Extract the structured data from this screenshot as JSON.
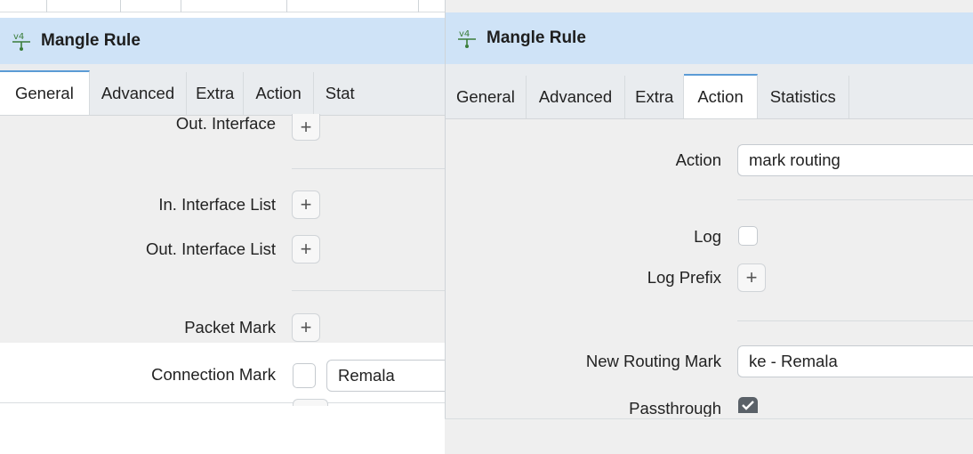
{
  "left_window": {
    "title": "Mangle Rule",
    "icon": "mangle-rule-icon",
    "tabs": [
      "General",
      "Advanced",
      "Extra",
      "Action",
      "Stat"
    ],
    "active_tab": "General",
    "fields": {
      "out_interface": "Out. Interface",
      "in_interface_list": "In. Interface List",
      "out_interface_list": "Out. Interface List",
      "packet_mark": "Packet Mark",
      "connection_mark": "Connection Mark",
      "connection_mark_value": "Remala"
    },
    "plus_symbol": "+"
  },
  "right_window": {
    "title": "Mangle Rule",
    "icon": "mangle-rule-icon",
    "tabs": [
      "General",
      "Advanced",
      "Extra",
      "Action",
      "Statistics"
    ],
    "active_tab": "Action",
    "fields": {
      "action": "Action",
      "action_value": "mark routing",
      "log": "Log",
      "log_prefix": "Log Prefix",
      "new_routing_mark": "New Routing Mark",
      "new_routing_mark_value": "ke - Remala",
      "passthrough": "Passthrough"
    },
    "log_checked": false,
    "passthrough_checked": true,
    "plus_symbol": "+"
  },
  "colors": {
    "titlebar": "#cfe3f7",
    "active_tab_accent": "#5b9bd5",
    "content_bg": "#efefef"
  }
}
